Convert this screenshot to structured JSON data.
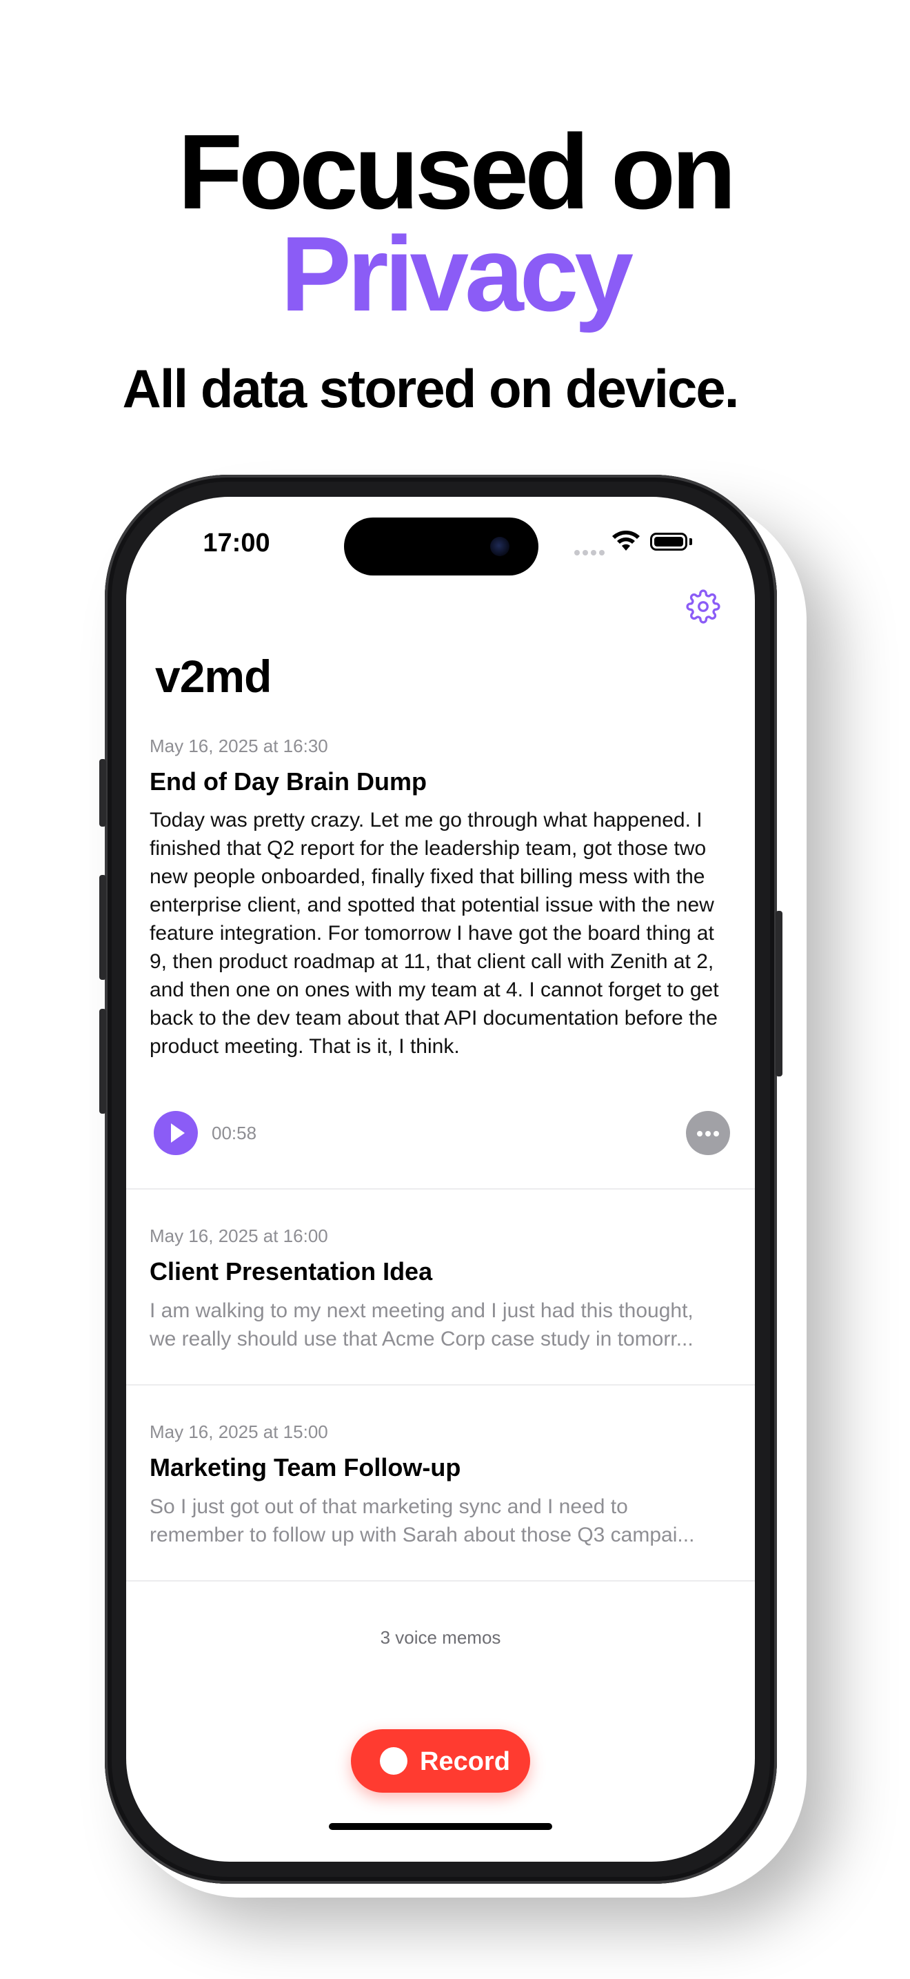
{
  "marketing": {
    "headline_line1": "Focused on",
    "headline_line2": "Privacy",
    "subheadline": "All data stored on device."
  },
  "status_bar": {
    "time": "17:00"
  },
  "app": {
    "title": "v2md"
  },
  "memos": [
    {
      "date": "May 16, 2025 at 16:30",
      "title": "End of Day Brain Dump",
      "body": "Today was pretty crazy. Let me go through what happened. I finished that Q2 report for the leadership team, got those two new people onboarded, finally fixed that billing mess with the enterprise client, and spotted that potential issue with the new feature integration. For tomorrow I have got the board thing at 9, then product roadmap at 11, that client call with Zenith at 2, and then one on ones with my team at 4. I cannot forget to get back to the dev team about that API documentation before the product meeting. That is it, I think.",
      "duration": "00:58"
    },
    {
      "date": "May 16, 2025 at 16:00",
      "title": "Client Presentation Idea",
      "preview_line1": "I am walking to my next meeting and I just had this thought,",
      "preview_line2": "we really should use that Acme Corp case study in tomorr..."
    },
    {
      "date": "May 16, 2025 at 15:00",
      "title": "Marketing Team Follow-up",
      "preview_line1": "So I just got out of that marketing sync and I need to",
      "preview_line2": "remember to follow up with Sarah about those Q3 campai..."
    }
  ],
  "footer": {
    "memo_count": "3 voice memos",
    "record_label": "Record"
  },
  "colors": {
    "accent_purple": "#8b5cf6",
    "record_red": "#ff3b30",
    "secondary_gray": "#8e8e93"
  },
  "icons": {
    "settings": "gear-icon",
    "play": "play-icon",
    "more": "ellipsis-icon",
    "record": "record-dot-icon"
  }
}
